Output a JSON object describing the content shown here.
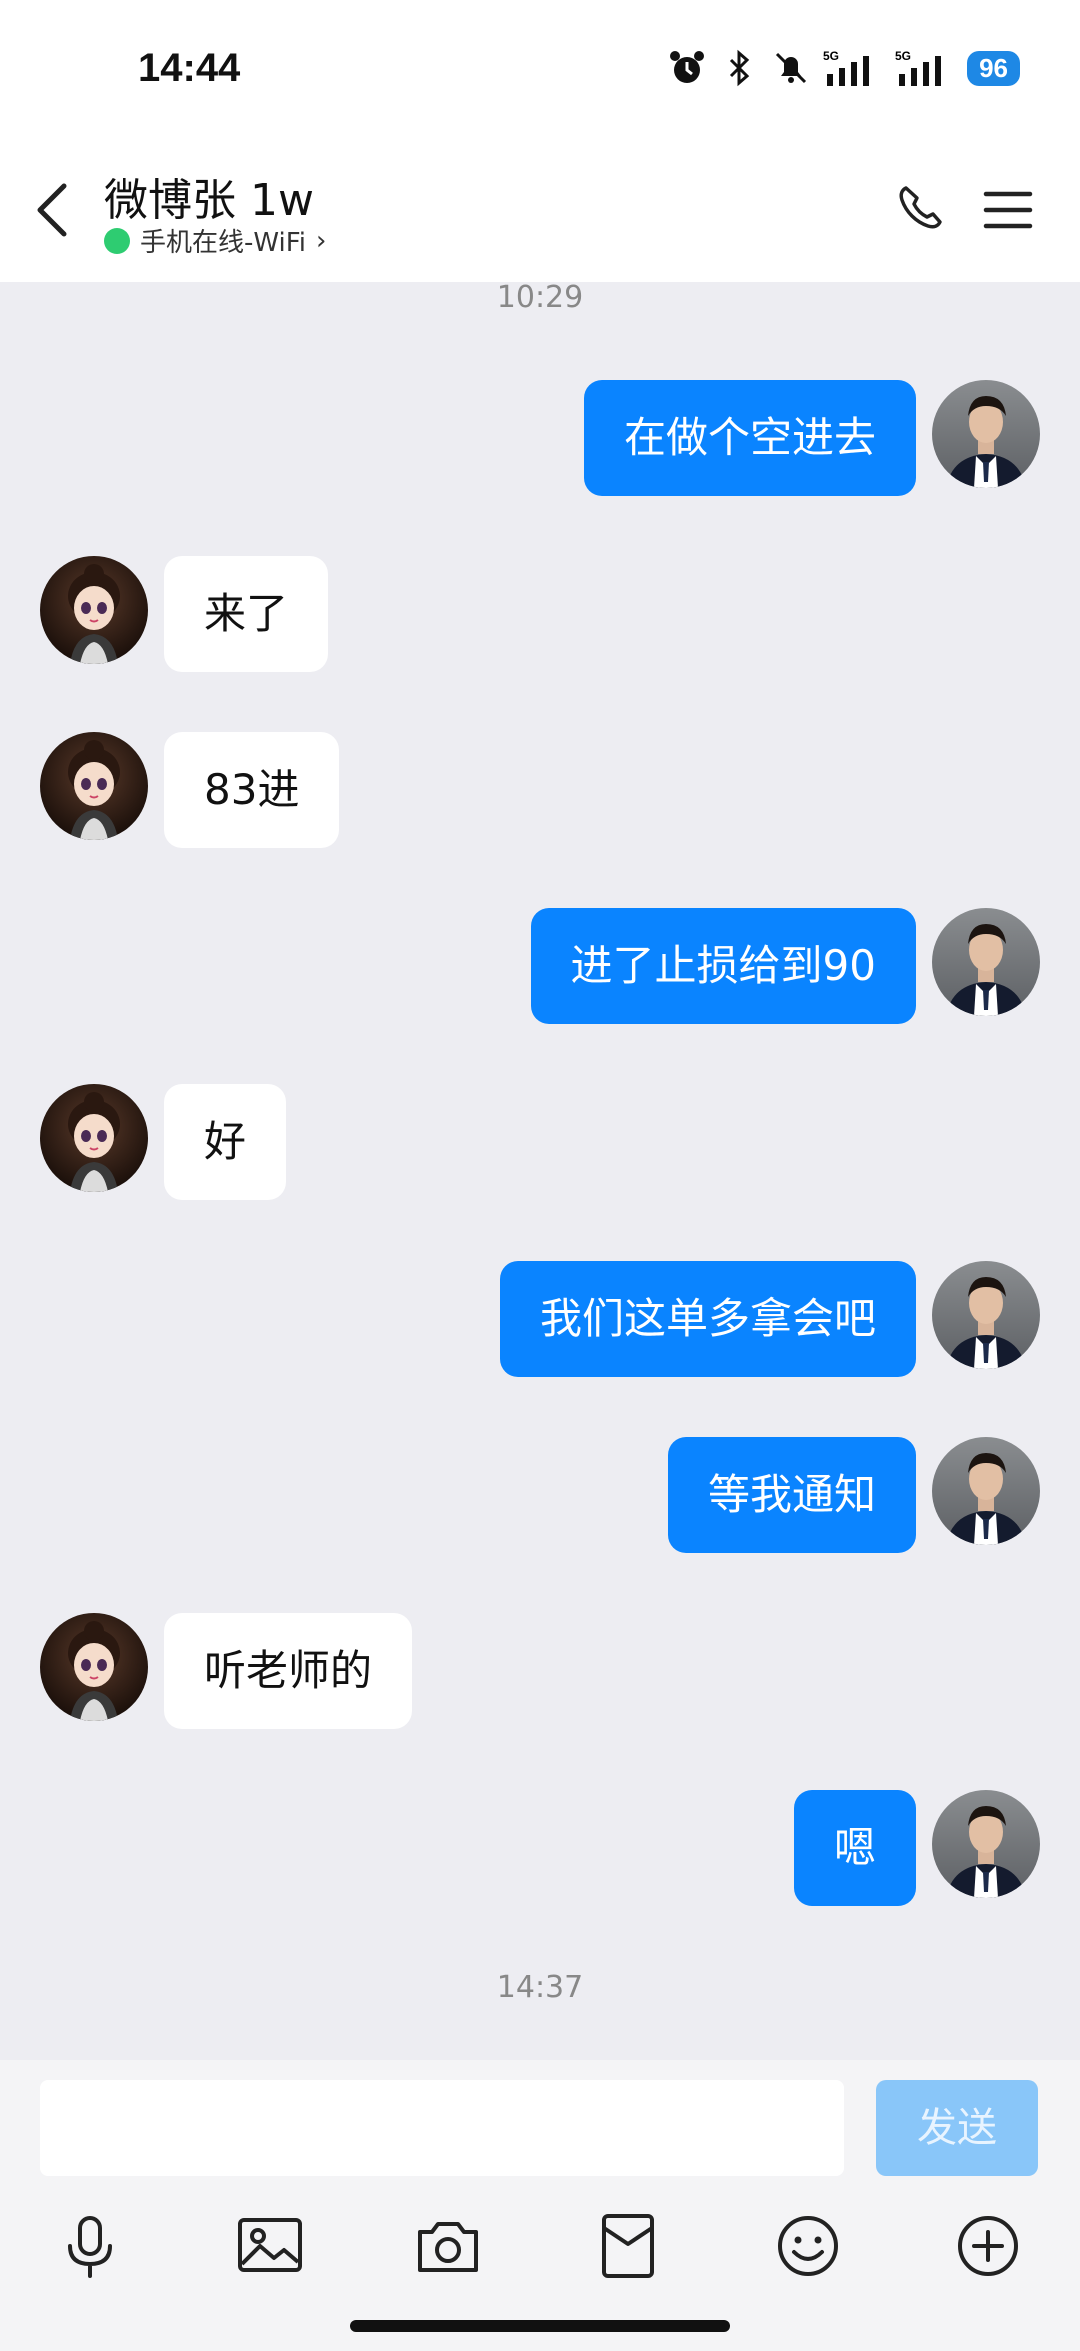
{
  "status_bar": {
    "time": "14:44",
    "battery": "96",
    "icons": [
      "alarm-icon",
      "bluetooth-icon",
      "mute-icon",
      "signal-5g-icon",
      "signal-5g-icon"
    ]
  },
  "header": {
    "title": "微博张 1w",
    "status": "手机在线-WiFi",
    "chevron": "›"
  },
  "messages": [
    {
      "type": "time",
      "text": "10:29"
    },
    {
      "side": "right",
      "text": "在做个空进去"
    },
    {
      "side": "left",
      "text": "来了"
    },
    {
      "side": "left",
      "text": "83进"
    },
    {
      "side": "right",
      "text": "进了止损给到90"
    },
    {
      "side": "left",
      "text": "好"
    },
    {
      "side": "right",
      "text": "我们这单多拿会吧"
    },
    {
      "side": "right",
      "text": "等我通知"
    },
    {
      "side": "left",
      "text": "听老师的"
    },
    {
      "side": "right",
      "text": "嗯"
    },
    {
      "type": "time",
      "text": "14:37"
    }
  ],
  "input": {
    "send_label": "发送"
  },
  "toolbar": [
    "microphone-icon",
    "image-icon",
    "camera-icon",
    "red-packet-icon",
    "emoji-icon",
    "plus-icon"
  ],
  "colors": {
    "sent_bubble": "#0a84ff",
    "received_bubble": "#ffffff",
    "background": "#ededf2",
    "send_button": "#89c6f9"
  }
}
